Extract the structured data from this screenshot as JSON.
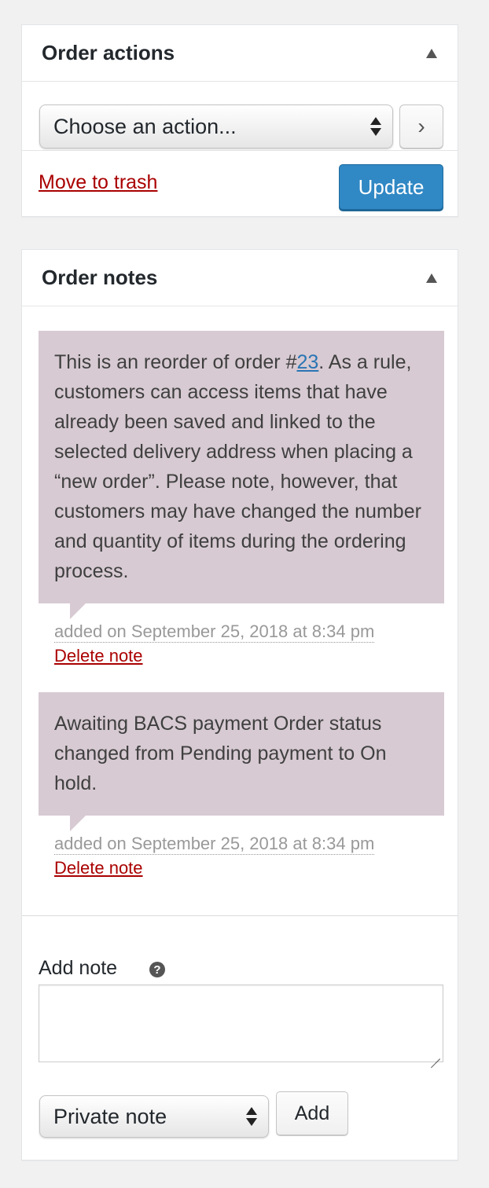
{
  "order_actions": {
    "title": "Order actions",
    "select_value": "Choose an action...",
    "go_label": "›",
    "trash_label": "Move to trash",
    "update_label": "Update"
  },
  "order_notes": {
    "title": "Order notes",
    "notes": [
      {
        "text_before": "This is an reorder of order #",
        "link_text": "23",
        "text_after": ". As a rule, customers can access items that have already been saved and linked to the selected delivery address when placing a “new order”. Please note, however, that customers may have changed the number and quantity of items during the ordering process.",
        "meta": "added on September 25, 2018 at 8:34 pm",
        "delete_label": "Delete note"
      },
      {
        "text": "Awaiting BACS payment Order status changed from Pending payment to On hold.",
        "meta": "added on September 25, 2018 at 8:34 pm",
        "delete_label": "Delete note"
      }
    ],
    "add_note_label": "Add note",
    "help_icon": "?",
    "textarea_value": "",
    "note_type_value": "Private note",
    "add_button_label": "Add"
  },
  "colors": {
    "note_background": "#d7cad2",
    "update_button": "#3088c4",
    "delete_link": "#aa0000",
    "note_link": "#2a75b4"
  }
}
